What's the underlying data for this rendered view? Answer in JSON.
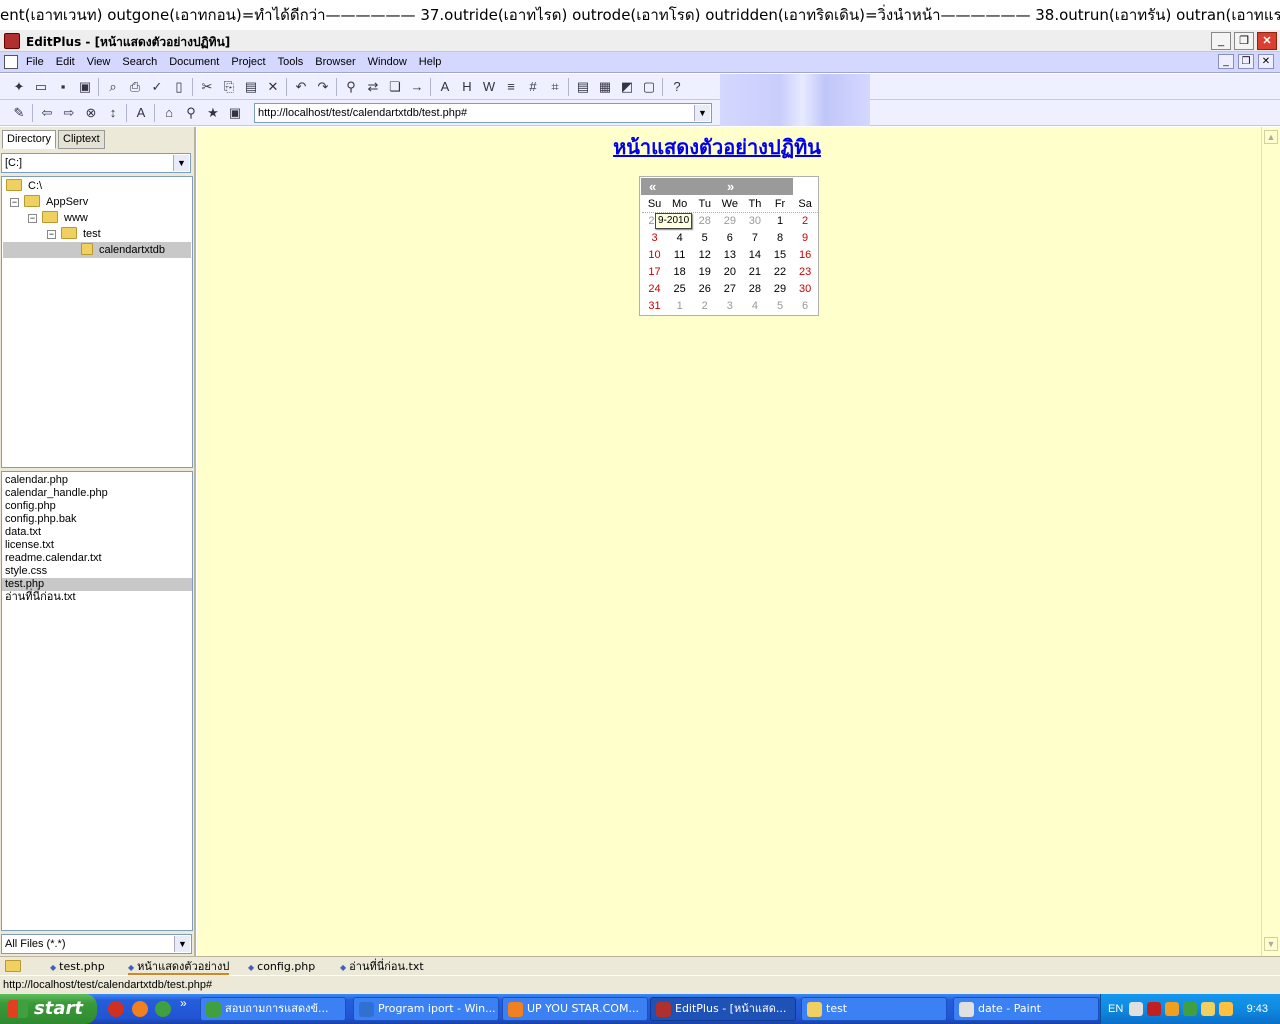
{
  "marquee": "ent(เอาทเวนท)  outgone(เอาทกอน)=ทำได้ดีกว่า——————  37.outride(เอาทไรด)  outrode(เอาทโรด)  outridden(เอาทริดเดิน)=วิ่งนำหน้า——————  38.outrun(เอาทรัน)  outran(เอาทแรน)  outrun(เอา",
  "window": {
    "title": "EditPlus - [หน้าแสดงตัวอย่างปฏิทิน]"
  },
  "menu": [
    "File",
    "Edit",
    "View",
    "Search",
    "Document",
    "Project",
    "Tools",
    "Browser",
    "Window",
    "Help"
  ],
  "browser": {
    "url": "http://localhost/test/calendartxtdb/test.php#"
  },
  "left_panel": {
    "tabs": [
      "Directory",
      "Cliptext"
    ],
    "drive": "[C:]",
    "tree": [
      "C:\\",
      "AppServ",
      "www",
      "test",
      "calendartxtdb"
    ],
    "files": [
      "calendar.php",
      "calendar_handle.php",
      "config.php",
      "config.php.bak",
      "data.txt",
      "license.txt",
      "readme.calendar.txt",
      "style.css",
      "test.php",
      "อ่านที่นี่ก่อน.txt"
    ],
    "selected_file": "test.php",
    "filter": "All Files (*.*)"
  },
  "page": {
    "title": "หน้าแสดงตัวอย่างปฏิทิน",
    "calendar": {
      "prev": "«",
      "next": "»",
      "weekdays": [
        "Su",
        "Mo",
        "Tu",
        "We",
        "Th",
        "Fr",
        "Sa"
      ],
      "weeks": [
        [
          "27",
          "28",
          "28",
          "29",
          "30",
          "1",
          "2"
        ],
        [
          "3",
          "4",
          "5",
          "6",
          "7",
          "8",
          "9"
        ],
        [
          "10",
          "11",
          "12",
          "13",
          "14",
          "15",
          "16"
        ],
        [
          "17",
          "18",
          "19",
          "20",
          "21",
          "22",
          "23"
        ],
        [
          "24",
          "25",
          "26",
          "27",
          "28",
          "29",
          "30"
        ],
        [
          "31",
          "1",
          "2",
          "3",
          "4",
          "5",
          "6"
        ]
      ],
      "tooltip": "9-2010",
      "weekend_color": "#cc0000"
    }
  },
  "doc_tabs": [
    "test.php",
    "หน้าแสดงตัวอย่างป",
    "config.php",
    "อ่านที่นี่ก่อน.txt"
  ],
  "active_doc_tab": 1,
  "status_bar": "http://localhost/test/calendartxtdb/test.php#",
  "taskbar": {
    "start": "start",
    "tasks": [
      "สอบถามการแสดงข้...",
      "Program iport - Win...",
      "UP YOU STAR.COM...",
      "EditPlus - [หน้าแสด...",
      "test",
      "date - Paint"
    ],
    "active_task": 3,
    "tray_lang": "EN",
    "clock": "9:43"
  }
}
